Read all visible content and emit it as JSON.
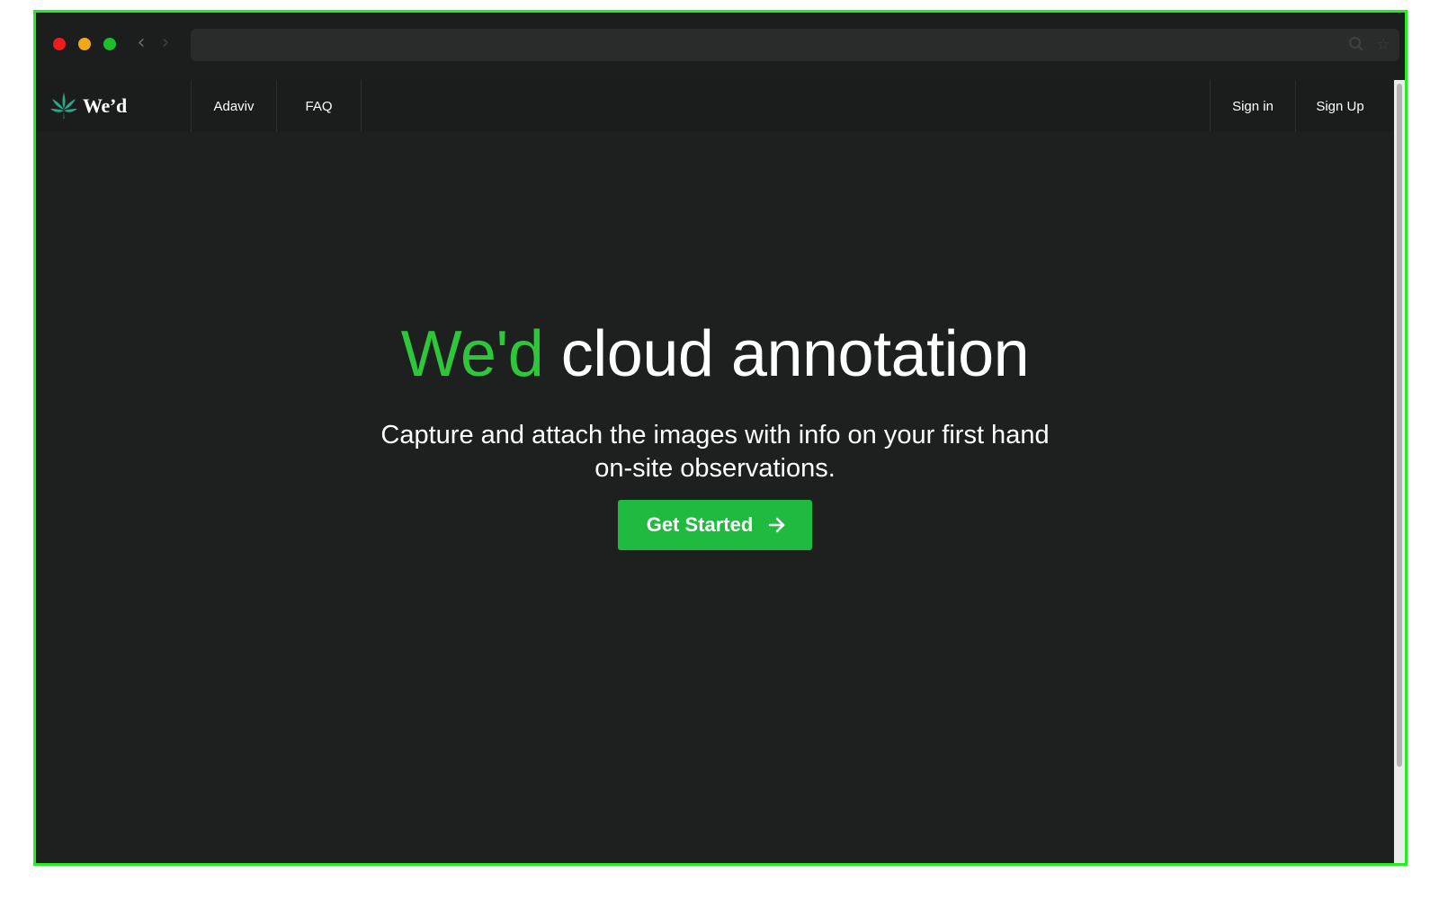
{
  "browser": {
    "controls": {
      "back_icon": "chevron-left-icon",
      "forward_icon": "chevron-right-icon",
      "search_icon": "search-icon",
      "bookmark_icon": "star-icon"
    },
    "address_bar": {
      "value": ""
    }
  },
  "nav": {
    "brand": "We’d",
    "links": [
      {
        "label": "Adaviv"
      },
      {
        "label": "FAQ"
      }
    ],
    "auth": {
      "sign_in": "Sign in",
      "sign_up": "Sign Up"
    }
  },
  "hero": {
    "title_brand": "We'd",
    "title_rest": "cloud annotation",
    "subtitle": "Capture and attach the images with info on your first hand on-site observations.",
    "cta_label": "Get Started",
    "cta_icon": "arrow-right-icon"
  },
  "colors": {
    "accent": "#2ec63b",
    "button": "#20ba40",
    "background": "#1e2020",
    "frame_outline": "#22ee22"
  }
}
